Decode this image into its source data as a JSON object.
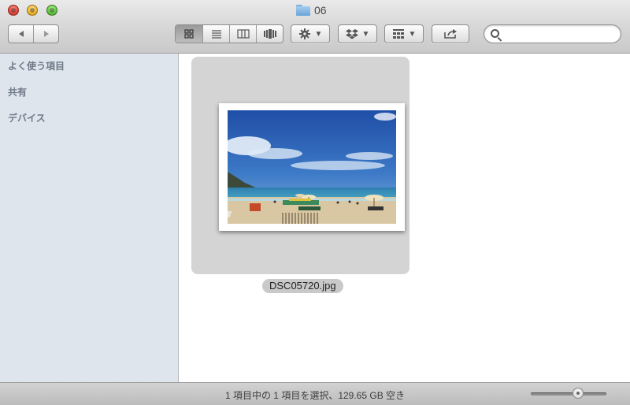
{
  "window": {
    "title": "06"
  },
  "toolbar": {
    "back_icon": "triangle-left-icon",
    "forward_icon": "triangle-right-icon",
    "view_modes": [
      {
        "name": "icon-view",
        "icon": "grid-icon",
        "active": true
      },
      {
        "name": "list-view",
        "icon": "lines-icon",
        "active": false
      },
      {
        "name": "column-view",
        "icon": "columns-icon",
        "active": false
      },
      {
        "name": "coverflow-view",
        "icon": "coverflow-icon",
        "active": false
      }
    ],
    "action_icon": "gear-icon",
    "dropbox_icon": "dropbox-icon",
    "arrange_icon": "arrange-grid-icon",
    "share_icon": "share-icon",
    "search": {
      "value": "",
      "placeholder": ""
    }
  },
  "sidebar": {
    "sections": [
      {
        "label": "よく使う項目"
      },
      {
        "label": "共有"
      },
      {
        "label": "デバイス"
      }
    ]
  },
  "files": [
    {
      "name": "DSC05720.jpg",
      "selected": true
    }
  ],
  "status": {
    "text": "1 項目中の 1 項目を選択、129.65 GB 空き"
  },
  "icon_size_slider": {
    "value": 0.62
  },
  "colors": {
    "sidebar_bg": "#dfe5ed",
    "selection_bg": "#d4d4d4",
    "sidebar_heading": "#6f7a87"
  }
}
